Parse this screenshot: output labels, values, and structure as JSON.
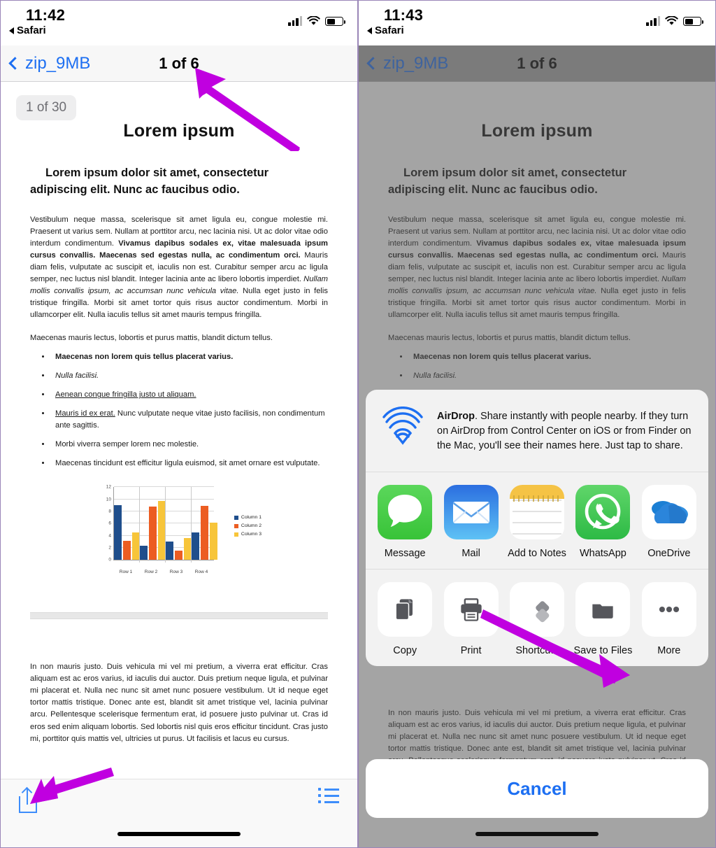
{
  "left_phone": {
    "status": {
      "time": "11:42",
      "back_app": "Safari",
      "signal": "signal-bars",
      "wifi": "wifi-icon",
      "battery": "battery-icon"
    },
    "nav": {
      "back_label": "zip_9MB",
      "title": "1 of 6"
    },
    "page_badge": "1 of 30",
    "document": {
      "title": "Lorem ipsum",
      "subtitle": "Lorem ipsum dolor sit amet, consectetur adipiscing elit. Nunc ac faucibus odio.",
      "para1_a": "Vestibulum neque massa, scelerisque sit amet ligula eu, congue molestie mi. Praesent ut varius sem. Nullam at porttitor arcu, nec lacinia nisi. Ut ac dolor vitae odio interdum condimentum. ",
      "para1_b": "Vivamus dapibus sodales ex, vitae malesuada ipsum cursus convallis. Maecenas sed egestas nulla, ac condimentum orci.",
      "para1_c": " Mauris diam felis, vulputate ac suscipit et, iaculis non est. Curabitur semper arcu ac ligula semper, nec luctus nisl blandit. Integer lacinia ante ac libero lobortis imperdiet. ",
      "para1_d": "Nullam mollis convallis ipsum, ac accumsan nunc vehicula vitae.",
      "para1_e": " Nulla eget justo in felis tristique fringilla. Morbi sit amet tortor quis risus auctor condimentum. Morbi in ullamcorper elit. Nulla iaculis tellus sit amet mauris tempus fringilla.",
      "para2": "Maecenas mauris lectus, lobortis et purus mattis, blandit dictum tellus.",
      "bullets": [
        {
          "text": "Maecenas non lorem quis tellus placerat varius.",
          "style": "bold"
        },
        {
          "text": "Nulla facilisi.",
          "style": "italic"
        },
        {
          "text": "Aenean congue fringilla justo ut aliquam. ",
          "style": "underline"
        },
        {
          "text": "Mauris id ex erat.",
          "style": "underline",
          "rest": " Nunc vulputate neque vitae justo facilisis, non condimentum ante sagittis."
        },
        {
          "text": "Morbi viverra semper lorem nec molestie.",
          "style": "plain"
        },
        {
          "text": "Maecenas tincidunt est efficitur ligula euismod, sit amet ornare est vulputate.",
          "style": "plain"
        }
      ],
      "page2_para": "In non mauris justo. Duis vehicula mi vel mi pretium, a viverra erat efficitur. Cras aliquam est ac eros varius, id iaculis dui auctor. Duis pretium neque ligula, et pulvinar mi placerat et. Nulla nec nunc sit amet nunc posuere vestibulum. Ut id neque eget tortor mattis tristique. Donec ante est, blandit sit amet tristique vel, lacinia pulvinar arcu. Pellentesque scelerisque fermentum erat, id posuere justo pulvinar ut. Cras id eros sed enim aliquam lobortis. Sed lobortis nisl quis eros efficitur tincidunt. Cras justo mi, porttitor quis mattis vel, ultricies ut purus. Ut facilisis et lacus eu cursus."
    },
    "toolbar": {
      "share_icon": "share-icon",
      "list_icon": "list-view-icon"
    }
  },
  "right_phone": {
    "status": {
      "time": "11:43",
      "back_app": "Safari"
    },
    "nav": {
      "back_label": "zip_9MB",
      "title": "1 of 6"
    },
    "share_sheet": {
      "airdrop": {
        "icon": "airdrop-icon",
        "title": "AirDrop",
        "body": ". Share instantly with people nearby. If they turn on AirDrop from Control Center on iOS or from Finder on the Mac, you'll see their names here. Just tap to share."
      },
      "apps": [
        {
          "label": "Message",
          "icon": "messages-icon"
        },
        {
          "label": "Mail",
          "icon": "mail-icon"
        },
        {
          "label": "Add to Notes",
          "icon": "notes-icon"
        },
        {
          "label": "WhatsApp",
          "icon": "whatsapp-icon"
        },
        {
          "label": "OneDrive",
          "icon": "onedrive-icon"
        }
      ],
      "actions": [
        {
          "label": "Copy",
          "icon": "copy-icon"
        },
        {
          "label": "Print",
          "icon": "print-icon"
        },
        {
          "label": "Shortcuts",
          "icon": "shortcuts-icon"
        },
        {
          "label": "Save to Files",
          "icon": "folder-icon"
        },
        {
          "label": "More",
          "icon": "more-ellipsis-icon"
        }
      ],
      "cancel_label": "Cancel"
    }
  },
  "annotations": {
    "arrow_color": "#c000e0",
    "arrows": [
      {
        "name": "arrow-to-page-counter"
      },
      {
        "name": "arrow-to-share-button"
      },
      {
        "name": "arrow-to-save-to-files"
      }
    ]
  },
  "chart_data": {
    "type": "bar",
    "title": "",
    "categories": [
      "Row 1",
      "Row 2",
      "Row 3",
      "Row 4"
    ],
    "series": [
      {
        "name": "Column 1",
        "color": "#1f4e8c",
        "values": [
          9.1,
          2.4,
          3.1,
          4.5
        ]
      },
      {
        "name": "Column 2",
        "color": "#ec5d22",
        "values": [
          3.2,
          8.8,
          1.5,
          8.9
        ]
      },
      {
        "name": "Column 3",
        "color": "#f7c53a",
        "values": [
          4.5,
          9.7,
          3.6,
          6.2
        ]
      }
    ],
    "yticks": [
      0,
      2,
      4,
      6,
      8,
      10,
      12
    ],
    "ylim": [
      0,
      12
    ],
    "xlabel": "",
    "ylabel": "",
    "grid": true,
    "legend_position": "right"
  }
}
